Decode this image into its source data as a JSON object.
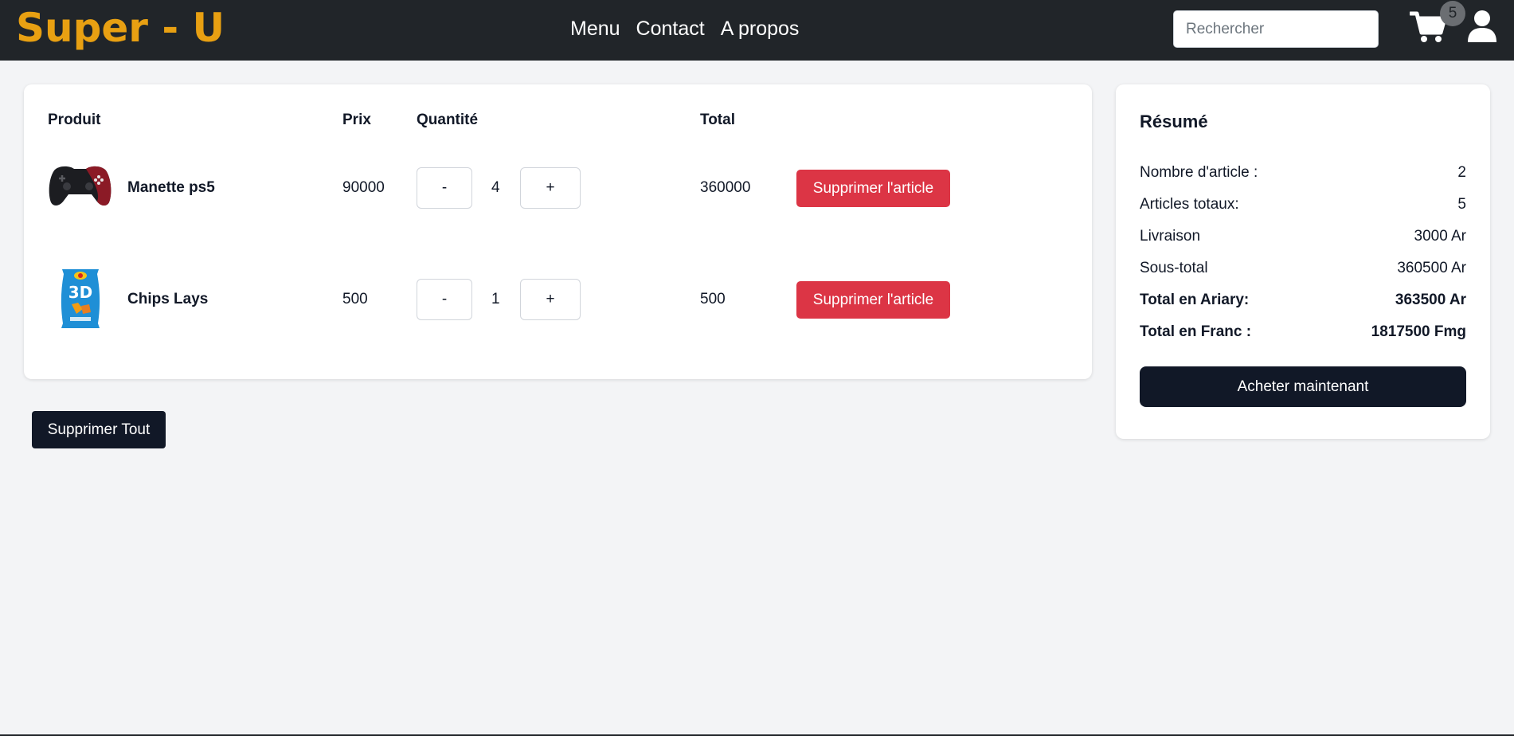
{
  "header": {
    "brand": "Super - U",
    "nav": [
      "Menu",
      "Contact",
      "A propos"
    ],
    "search_placeholder": "Rechercher",
    "cart_count": "5",
    "icons": {
      "cart": "cart-icon",
      "user": "user-icon"
    },
    "colors": {
      "bar": "#212529",
      "brand": "#e8a012"
    }
  },
  "cart": {
    "headers": {
      "product": "Produit",
      "price": "Prix",
      "quantity": "Quantité",
      "total": "Total"
    },
    "items": [
      {
        "name": "Manette ps5",
        "price": "90000",
        "qty": "4",
        "total": "360000",
        "minus": "-",
        "plus": "+",
        "delete": "Supprimer l'article",
        "image": "ps5-controller-image"
      },
      {
        "name": "Chips Lays",
        "price": "500",
        "qty": "1",
        "total": "500",
        "minus": "-",
        "plus": "+",
        "delete": "Supprimer l'article",
        "image": "lays-chips-bag-image"
      }
    ],
    "clear_all": "Supprimer Tout"
  },
  "summary": {
    "title": "Résumé",
    "rows": [
      {
        "label": "Nombre d'article :",
        "value": "2"
      },
      {
        "label": "Articles totaux:",
        "value": "5"
      },
      {
        "label": "Livraison",
        "value": "3000 Ar"
      },
      {
        "label": "Sous-total",
        "value": "360500 Ar"
      },
      {
        "label": "Total en Ariary:",
        "value": "363500 Ar"
      },
      {
        "label": "Total en Franc :",
        "value": "1817500 Fmg"
      }
    ],
    "buy": "Acheter maintenant"
  }
}
